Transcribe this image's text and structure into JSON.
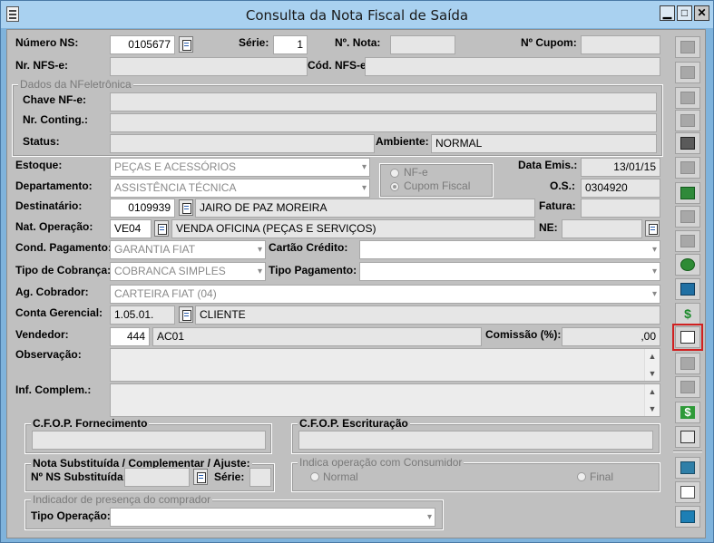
{
  "window": {
    "title": "Consulta da Nota Fiscal de Saída",
    "controls": [
      "▁",
      "□",
      "✕"
    ]
  },
  "header": {
    "numero_ns_label": "Número NS:",
    "numero_ns": "0105677",
    "serie_label": "Série:",
    "serie": "1",
    "nota_label": "Nº. Nota:",
    "nota": "",
    "cupom_label": "Nº Cupom:",
    "cupom": "",
    "nfse_label": "Nr. NFS-e:",
    "nfse": "",
    "cod_nfse_label": "Cód. NFS-e:",
    "cod_nfse": ""
  },
  "nfe": {
    "group_title": "Dados da NFeletrônica",
    "chave_label": "Chave NF-e:",
    "chave": "",
    "contig_label": "Nr. Conting.:",
    "contig": "",
    "status_label": "Status:",
    "status": "",
    "ambiente_label": "Ambiente:",
    "ambiente": "NORMAL"
  },
  "details": {
    "estoque_label": "Estoque:",
    "estoque": "PEÇAS E ACESSÓRIOS",
    "departamento_label": "Departamento:",
    "departamento": "ASSISTÊNCIA TÉCNICA",
    "radio_nfe": "NF-e",
    "radio_cupom": "Cupom Fiscal",
    "data_emis_label": "Data Emis.:",
    "data_emis": "13/01/15",
    "os_label": "O.S.:",
    "os": "0304920",
    "destinatario_label": "Destinatário:",
    "destinatario_code": "0109939",
    "destinatario_name": "JAIRO DE PAZ MOREIRA",
    "fatura_label": "Fatura:",
    "fatura": "",
    "nat_op_label": "Nat. Operação:",
    "nat_op_code": "VE04",
    "nat_op_name": "VENDA OFICINA (PEÇAS E SERVIÇOS)",
    "ne_label": "NE:",
    "ne": "",
    "cond_pag_label": "Cond. Pagamento:",
    "cond_pag": "GARANTIA FIAT",
    "cartao_label": "Cartão Crédito:",
    "cartao": "",
    "tipo_cobranca_label": "Tipo de Cobrança:",
    "tipo_cobranca": "COBRANCA SIMPLES",
    "tipo_pag_label": "Tipo Pagamento:",
    "tipo_pag": "",
    "ag_cobrador_label": "Ag. Cobrador:",
    "ag_cobrador": "CARTEIRA FIAT (04)",
    "conta_label": "Conta Gerencial:",
    "conta_code": "1.05.01.",
    "conta_name": "CLIENTE",
    "vendedor_label": "Vendedor:",
    "vendedor_code": "444",
    "vendedor_name": "AC01",
    "comissao_label": "Comissão (%):",
    "comissao": ",00",
    "observacao_label": "Observação:",
    "inf_complem_label": "Inf. Complem.:"
  },
  "cfop": {
    "fornecimento_title": "C.F.O.P. Fornecimento",
    "escrituracao_title": "C.F.O.P. Escrituração"
  },
  "substituida": {
    "group_title": "Nota Substituída / Complementar / Ajuste:",
    "ns_label": "Nº NS Substituída:",
    "serie_label": "Série:"
  },
  "consumidor": {
    "group_title": "Indica operação com Consumidor",
    "normal": "Normal",
    "final": "Final"
  },
  "presenca": {
    "group_title": "Indicador de presença do comprador",
    "tipo_label": "Tipo Operação:",
    "tipo": ""
  },
  "toolbar": {
    "buttons": [
      "insert-row-icon",
      "table-edit-icon",
      "list-icon",
      "preview-icon",
      "print-document-icon",
      "truck-icon",
      "reload-document-icon",
      "trash-icon",
      "printer-icon",
      "money-bag-icon",
      "transfer-icon",
      "dollar-icon",
      "edit-document-icon",
      "merge-icon",
      "columns-icon",
      "dollar-icon",
      "export-icon",
      "save-edit-icon",
      "grid-icon",
      "exit-door-icon"
    ]
  },
  "colors": {
    "window_bg": "#7fb3dc",
    "client_bg": "#c0c0c0",
    "field_bg": "#e6e6e6",
    "selection_outline": "#d02020"
  }
}
